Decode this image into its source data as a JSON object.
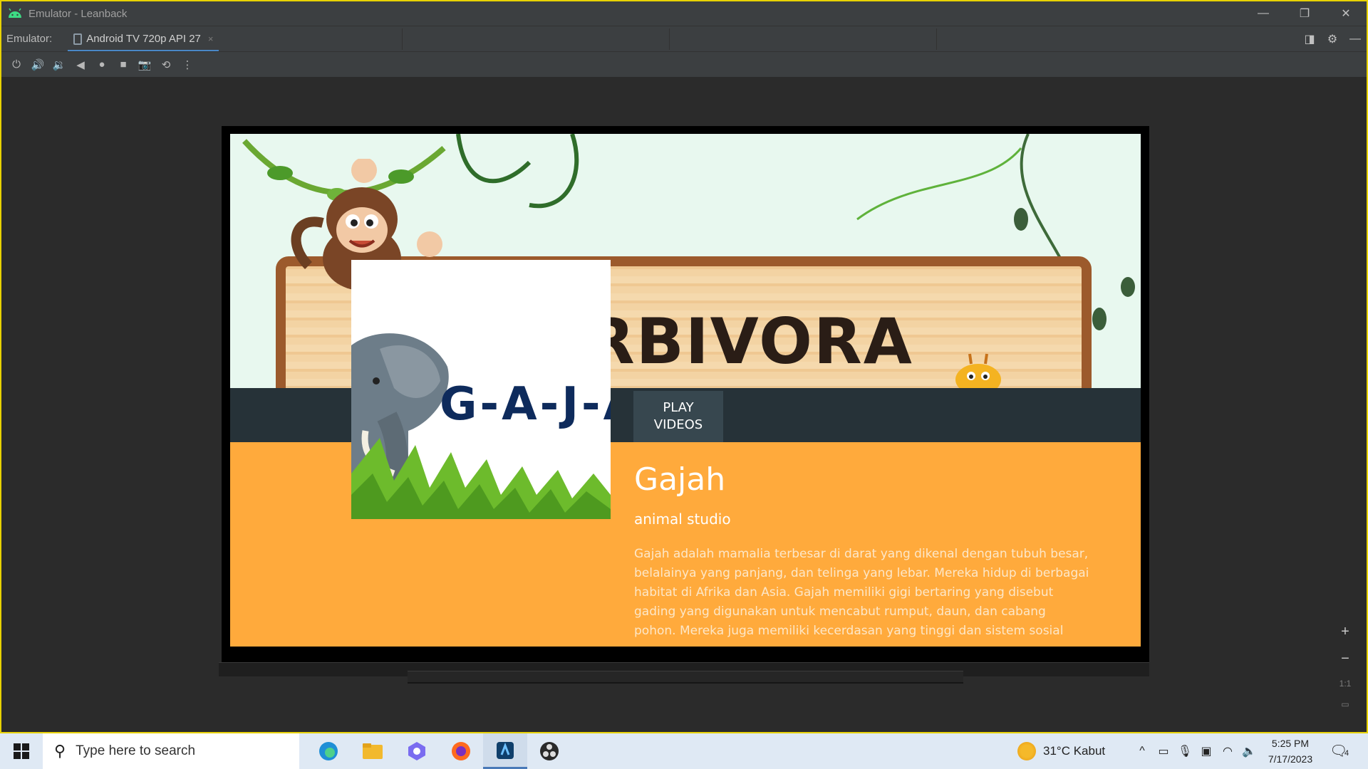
{
  "window": {
    "title": "Emulator - Leanback",
    "controls": [
      "—",
      "❐",
      "✕"
    ]
  },
  "tabbar": {
    "label": "Emulator:",
    "tab_label": "Android TV 720p API 27",
    "tab_close": "×"
  },
  "toolbar": {
    "icons": [
      "power-icon",
      "volume-up-icon",
      "volume-down-icon",
      "back-icon",
      "home-icon",
      "overview-icon",
      "screenshot-icon",
      "rotate-icon",
      "more-icon"
    ]
  },
  "app": {
    "banner_wordmark": "RBIVORA",
    "poster_text": "G-A-J-A",
    "play_button": "PLAY VIDEOS",
    "title": "Gajah",
    "subtitle": "animal studio",
    "description": "Gajah adalah mamalia terbesar di darat yang dikenal dengan tubuh besar, belalainya yang panjang, dan telinga yang lebar. Mereka hidup di berbagai habitat di Afrika dan Asia. Gajah memiliki gigi bertaring yang disebut gading yang digunakan untuk mencabut rumput, daun, dan cabang pohon. Mereka juga memiliki kecerdasan yang tinggi dan sistem sosial yang ko..."
  },
  "zoom": {
    "zoom_in": "+",
    "zoom_out": "−",
    "actual_size": "1:1"
  },
  "taskbar": {
    "search_placeholder": "Type here to search",
    "weather": "31°C  Kabut",
    "time": "5:25 PM",
    "date": "7/17/2023",
    "notification_count": "4"
  },
  "colors": {
    "accent": "#4a88c7",
    "details_bg": "#ffaa3c",
    "info_bar": "#263238",
    "play_button_bg": "#37474f",
    "poster_text": "#0e2b5c"
  }
}
